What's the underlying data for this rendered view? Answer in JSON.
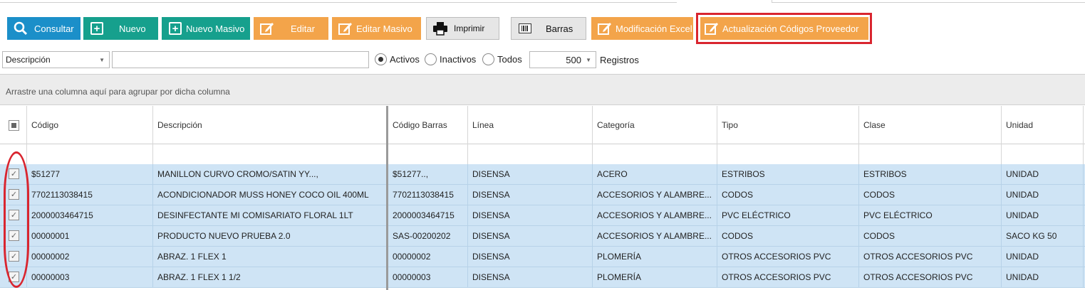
{
  "toolbar": {
    "consultar": "Consultar",
    "nuevo": "Nuevo",
    "nuevo_masivo": "Nuevo Masivo",
    "editar": "Editar",
    "editar_masivo": "Editar Masivo",
    "imprimir": "Imprimir",
    "barras": "Barras",
    "modificacion_excel": "Modificación Excel",
    "actualizacion": "Actualización Códigos Proveedor"
  },
  "filter": {
    "field_selected": "Descripción",
    "search_value": "",
    "radio_activos": "Activos",
    "radio_inactivos": "Inactivos",
    "radio_todos": "Todos",
    "radio_selected": "Activos",
    "records_count": "500",
    "records_label": "Registros"
  },
  "grid": {
    "group_hint": "Arrastre una columna aquí para agrupar por dicha columna",
    "columns": [
      "Código",
      "Descripción",
      "Código Barras",
      "Línea",
      "Categoría",
      "Tipo",
      "Clase",
      "Unidad"
    ],
    "rows": [
      {
        "codigo": "$51277",
        "descripcion": "MANILLON CURVO CROMO/SATIN YY...,",
        "barras": "$51277..,",
        "linea": "DISENSA",
        "categoria": "ACERO",
        "tipo": "ESTRIBOS",
        "clase": "ESTRIBOS",
        "unidad": "UNIDAD"
      },
      {
        "codigo": "7702113038415",
        "descripcion": "ACONDICIONADOR MUSS HONEY COCO OIL 400ML",
        "barras": "7702113038415",
        "linea": "DISENSA",
        "categoria": "ACCESORIOS Y ALAMBRE...",
        "tipo": "CODOS",
        "clase": "CODOS",
        "unidad": "UNIDAD"
      },
      {
        "codigo": "2000003464715",
        "descripcion": "DESINFECTANTE MI COMISARIATO FLORAL 1LT",
        "barras": "2000003464715",
        "linea": "DISENSA",
        "categoria": "ACCESORIOS Y ALAMBRE...",
        "tipo": "PVC ELÉCTRICO",
        "clase": "PVC ELÉCTRICO",
        "unidad": "UNIDAD"
      },
      {
        "codigo": "00000001",
        "descripcion": "PRODUCTO NUEVO PRUEBA 2.0",
        "barras": "SAS-00200202",
        "linea": "DISENSA",
        "categoria": "ACCESORIOS Y ALAMBRE...",
        "tipo": "CODOS",
        "clase": "CODOS",
        "unidad": "SACO KG 50"
      },
      {
        "codigo": "00000002",
        "descripcion": "ABRAZ. 1 FLEX  1",
        "barras": "00000002",
        "linea": "DISENSA",
        "categoria": "PLOMERÍA",
        "tipo": "OTROS ACCESORIOS PVC",
        "clase": "OTROS ACCESORIOS PVC",
        "unidad": "UNIDAD"
      },
      {
        "codigo": "00000003",
        "descripcion": "ABRAZ. 1 FLEX  1 1/2",
        "barras": "00000003",
        "linea": "DISENSA",
        "categoria": "PLOMERÍA",
        "tipo": "OTROS ACCESORIOS PVC",
        "clase": "OTROS ACCESORIOS PVC",
        "unidad": "UNIDAD"
      }
    ]
  },
  "colors": {
    "blue": "#1b8fc9",
    "green": "#16a08d",
    "orange": "#f3a44a",
    "row_selected": "#cfe4f5",
    "highlight_red": "#d9252f"
  }
}
